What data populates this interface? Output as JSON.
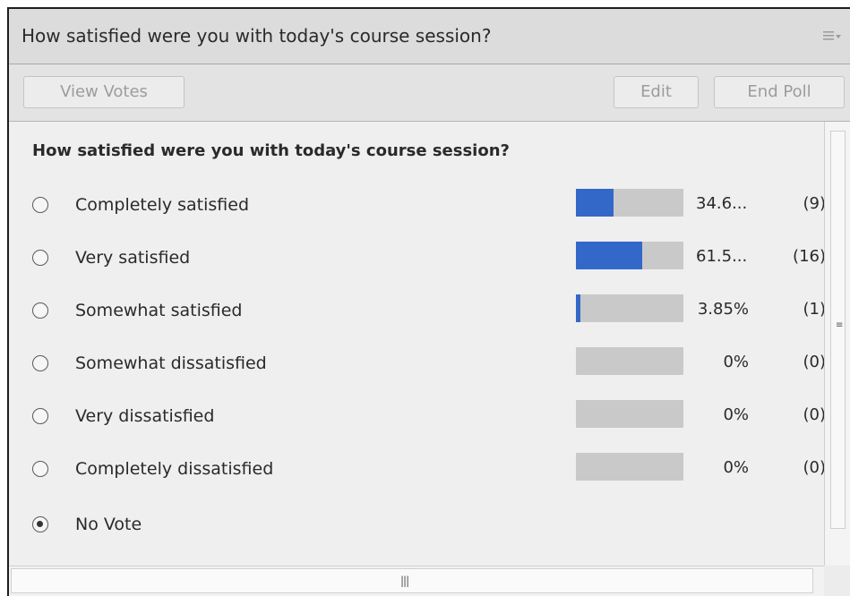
{
  "window": {
    "title": "How satisfied were you with today's course session?",
    "menu_icon": "menu-lines-icon"
  },
  "toolbar": {
    "view_votes_label": "View Votes",
    "edit_label": "Edit",
    "end_poll_label": "End Poll"
  },
  "poll": {
    "question": "How satisfied were you with today's course session?",
    "colors": {
      "bar_fill": "#3368c9",
      "bar_track": "#c9c9c9"
    },
    "options": [
      {
        "label": "Completely satisfied",
        "percent_text": "34.6...",
        "count_text": "(9)",
        "fill": 0.346
      },
      {
        "label": "Very satisfied",
        "percent_text": "61.5...",
        "count_text": "(16)",
        "fill": 0.615
      },
      {
        "label": "Somewhat satisfied",
        "percent_text": "3.85%",
        "count_text": "(1)",
        "fill": 0.0385
      },
      {
        "label": "Somewhat dissatisfied",
        "percent_text": "0%",
        "count_text": "(0)",
        "fill": 0
      },
      {
        "label": "Very dissatisfied",
        "percent_text": "0%",
        "count_text": "(0)",
        "fill": 0
      },
      {
        "label": "Completely dissatisfied",
        "percent_text": "0%",
        "count_text": "(0)",
        "fill": 0
      }
    ],
    "no_vote_label": "No Vote"
  }
}
